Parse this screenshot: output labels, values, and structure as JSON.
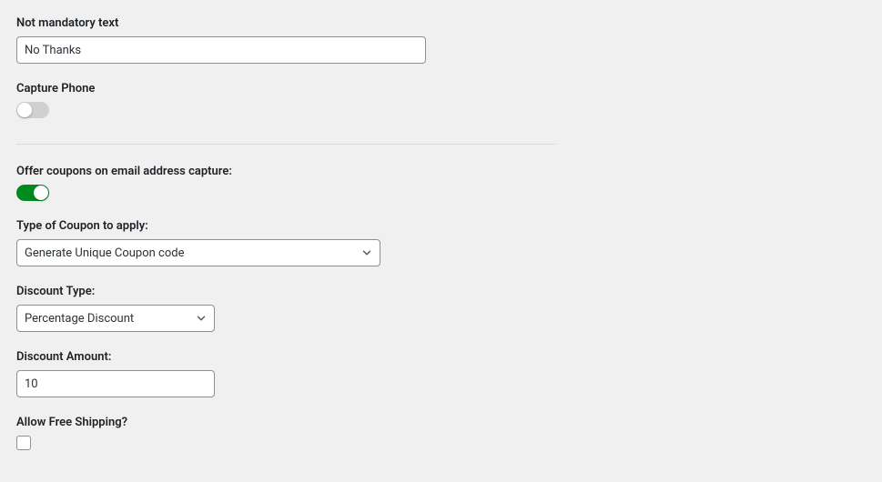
{
  "notMandatoryText": {
    "label": "Not mandatory text",
    "value": "No Thanks"
  },
  "capturePhone": {
    "label": "Capture Phone",
    "enabled": false
  },
  "offerCoupons": {
    "label": "Offer coupons on email address capture:",
    "enabled": true
  },
  "couponType": {
    "label": "Type of Coupon to apply:",
    "value": "Generate Unique Coupon code"
  },
  "discountType": {
    "label": "Discount Type:",
    "value": "Percentage Discount"
  },
  "discountAmount": {
    "label": "Discount Amount:",
    "value": "10"
  },
  "allowFreeShipping": {
    "label": "Allow Free Shipping?",
    "checked": false
  }
}
